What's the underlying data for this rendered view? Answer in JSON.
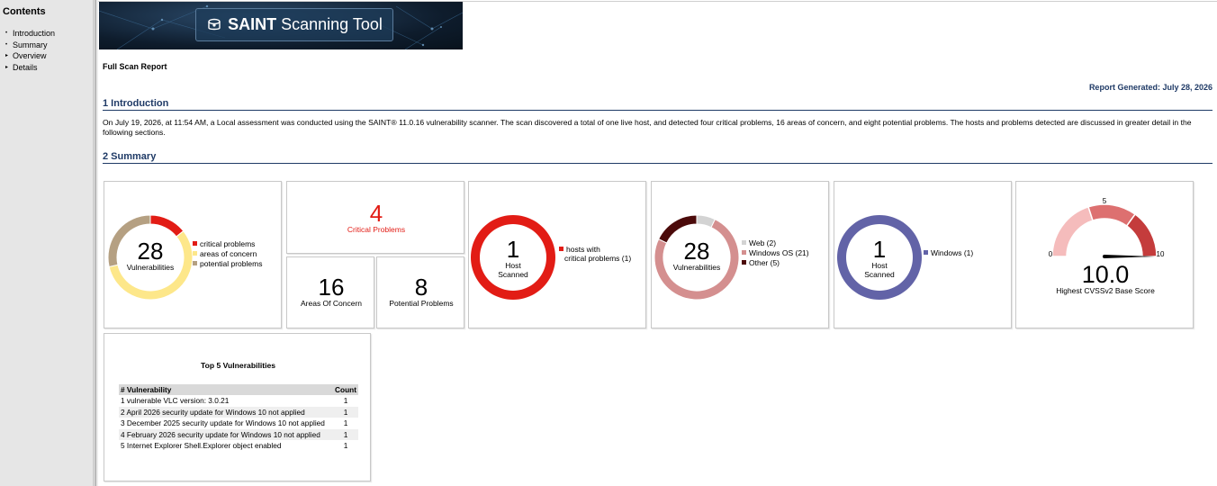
{
  "sidebar": {
    "title": "Contents",
    "items": [
      {
        "label": "Introduction",
        "marker": "•"
      },
      {
        "label": "Summary",
        "marker": "•"
      },
      {
        "label": "Overview",
        "marker": "▸"
      },
      {
        "label": "Details",
        "marker": "▸"
      }
    ]
  },
  "banner": {
    "brand": "SAINT",
    "product": "Scanning Tool"
  },
  "report": {
    "type": "Full Scan Report",
    "generated": "Report Generated: July 28, 2026"
  },
  "sections": {
    "intro_title": "1  Introduction",
    "intro_text": "On July 19, 2026, at 11:54 AM, a Local assessment was conducted using the SAINT® 11.0.16 vulnerability scanner. The scan discovered a total of one live host, and detected four critical problems, 16 areas of concern, and eight potential problems. The hosts and problems detected are discussed in greater detail in the following sections.",
    "summary_title": "2  Summary"
  },
  "colors": {
    "critical": "#e21c15",
    "concern": "#fde78a",
    "potential": "#b5a082",
    "web": "#d3d3d3",
    "windows": "#d48f8f",
    "other": "#4b0a0a",
    "host_os": "#6263a7",
    "accent": "#1f3a66"
  },
  "panels": {
    "vulnerabilities": {
      "total": "28",
      "label": "Vulnerabilities",
      "legend": [
        "critical problems",
        "areas of concern",
        "potential problems"
      ],
      "segments": [
        4,
        16,
        8
      ]
    },
    "critical": {
      "value": "4",
      "label": "Critical Problems"
    },
    "concern": {
      "value": "16",
      "label": "Areas Of Concern"
    },
    "potential": {
      "value": "8",
      "label": "Potential Problems"
    },
    "host_critical": {
      "value": "1",
      "label_line1": "Host",
      "label_line2": "Scanned",
      "legend_line1": "hosts with",
      "legend_line2": "critical problems (1)",
      "segments": [
        1
      ]
    },
    "vuln_category": {
      "total": "28",
      "label": "Vulnerabilities",
      "legend": [
        "Web (2)",
        "Windows OS (21)",
        "Other (5)"
      ],
      "segments": [
        2,
        21,
        5
      ]
    },
    "host_os": {
      "value": "1",
      "label_line1": "Host",
      "label_line2": "Scanned",
      "legend": "Windows (1)",
      "segments": [
        1
      ]
    },
    "cvss": {
      "score": "10.0",
      "score_value": 10,
      "label": "Highest CVSSv2 Base Score",
      "min": "0",
      "mid": "5",
      "max": "10"
    }
  },
  "top5": {
    "title": "Top 5 Vulnerabilities",
    "columns": [
      "# Vulnerability",
      "Count"
    ],
    "rows": [
      {
        "text": "1 vulnerable VLC version: 3.0.21",
        "count": "1"
      },
      {
        "text": "2 April 2026 security update for Windows 10 not applied",
        "count": "1"
      },
      {
        "text": "3 December 2025 security update for Windows 10 not applied",
        "count": "1"
      },
      {
        "text": "4 February 2026 security update for Windows 10 not applied",
        "count": "1"
      },
      {
        "text": "5 Internet Explorer Shell.Explorer object enabled",
        "count": "1"
      }
    ]
  }
}
